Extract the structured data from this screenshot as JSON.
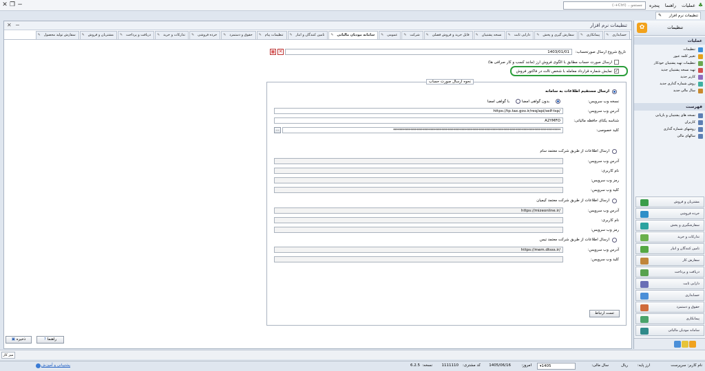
{
  "topbar": {
    "menu_ops": "عملیات",
    "menu_help": "راهنما",
    "menu_window": "پنجره",
    "search_placeholder": "جستجو... (Ctrl+-)"
  },
  "doc_tab": "تنظیمات نرم افزار",
  "main": {
    "title": "تنظیمات نرم افزار",
    "tabs": [
      "حسابداری",
      "پیمانکاری",
      "سفارش گیری و پخش",
      "دارایی ثابت",
      "نسخه پشتیبان",
      "فایل خرید و فروش فصلی",
      "شرکت",
      "عمومی",
      "سامانه مودیان مالیاتی",
      "تامین کنندگان و انبار",
      "تنظیمات پیام",
      "حقوق و دستمزد",
      "خرده فروشی",
      "تدارکات و خرید",
      "دریافت و پرداخت",
      "مشتریان و فروش",
      "سفارش تولید محصول"
    ],
    "active_tab_index": 8,
    "start_date_label": "تاریخ شروع ارسال صورتحساب:",
    "start_date": "1403/01/01",
    "chk_pattern_label": "ارسال صورت حساب مطابق با الگوی فروش ارز (مانند کسب و کار صرافی ها)",
    "chk_contract_label": "نمایش شماره قرارداد معامله با شخص ثالث در فاکتور فروش",
    "chk_contract_checked": true,
    "group_title": "نحوه ارسال صورت حساب",
    "direct_label": "ارسال مستقیم اطلاعات به سامانه",
    "version_label": "نسخه وب سرویس:",
    "no_cert_label": "بدون گواهی امضا",
    "with_cert_label": "با گواهی امضا",
    "ws_url_label": "آدرس وب سرویس:",
    "ws_url": "https://tp.tax.gov.ir/req/api/self-tsp/",
    "memory_id_label": "شناسه یکتای حافظه مالیاتی:",
    "memory_id": "A2YMFO",
    "private_key_label": "کلید خصوصی:",
    "private_key": "************************************************************************************************************",
    "sam_label": "ارسال اطلاعات از طریق شرکت معتمد سام",
    "user_label": "نام کاربری:",
    "ws_pass_label": "رمز وب سرویس:",
    "ws_key_label": "کلید وب سرویس:",
    "kimia_label": "ارسال اطلاعات از طریق شرکت معتمد کیمیان",
    "kimia_url": "https://mizeonline.ir/",
    "pass_label": "رمز وب سرویس:",
    "tis_label": "ارسال اطلاعات از طریق شرکت معتمد تیس",
    "tis_url": "https://mem.dtsss.ir/",
    "test_btn": "تست ارتباط"
  },
  "right_panel": {
    "title": "تنظیمات",
    "ops_title": "عملیات",
    "ops": [
      "تنظیمات",
      "تغییر کلمه عبور",
      "تنظیمات تهیه پشتیبان خودکار",
      "تهیه نسخه پشتیبان جدید",
      "کاربر جدید",
      "روش شماره گذاری جدید",
      "سال مالی جدید"
    ],
    "list_title": "فهرست",
    "list": [
      "نسخه های پشتیبان و بازیابی",
      "کاربران",
      "روشهای شماره گذاری",
      "سالهای مالی"
    ],
    "nav": [
      "مشتریان و فروش",
      "خرده فروشی",
      "سفارشگیری و پخش",
      "تدارکات و خرید",
      "تامین کنندگان و انبار",
      "سفارش کار",
      "دریافت و پرداخت",
      "دارایی ثابت",
      "حسابداری",
      "حقوق و دستمزد",
      "پیمانکاری",
      "سامانه مودیان مالیاتی"
    ]
  },
  "bottom": {
    "save": "ذخیره",
    "help": "راهنما",
    "desk": "میز کار"
  },
  "status": {
    "user": "نام کاربر: سرپرست",
    "base_currency": "ارز پایه:",
    "currency": "ریال",
    "fiscal_label": "سال مالی:",
    "fiscal": "1405",
    "today_label": "امروز:",
    "today": "1405/06/16",
    "customer_label": "کد مشتری:",
    "customer": "1111110",
    "version_label": "نسخه:",
    "version": "6.2.5",
    "support": "پشتیبانی و آموزش"
  }
}
